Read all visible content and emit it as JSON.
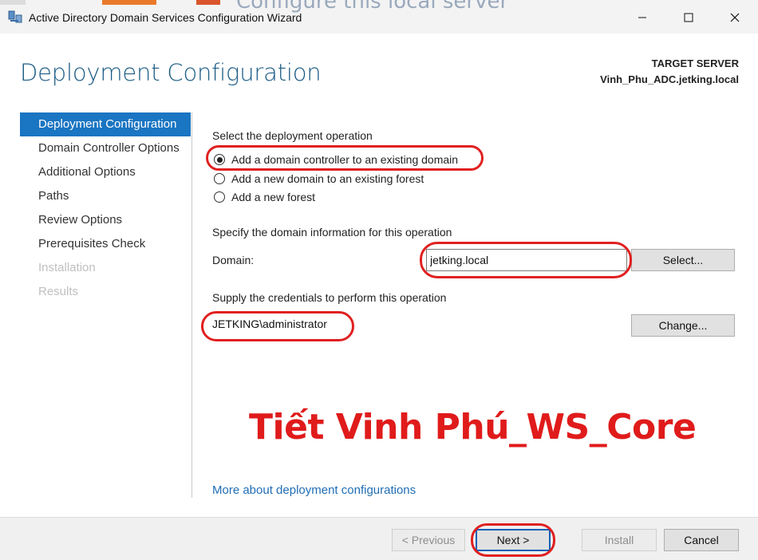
{
  "window": {
    "title": "Active Directory Domain Services Configuration Wizard",
    "background_text": "Configure this local server",
    "app_icon": "ad-ds-icon"
  },
  "header": {
    "page_title": "Deployment Configuration",
    "target_label": "TARGET SERVER",
    "target_name": "Vinh_Phu_ADC.jetking.local"
  },
  "nav": {
    "items": [
      {
        "label": "Deployment Configuration",
        "state": "active"
      },
      {
        "label": "Domain Controller Options",
        "state": "enabled"
      },
      {
        "label": "Additional Options",
        "state": "enabled"
      },
      {
        "label": "Paths",
        "state": "enabled"
      },
      {
        "label": "Review Options",
        "state": "enabled"
      },
      {
        "label": "Prerequisites Check",
        "state": "enabled"
      },
      {
        "label": "Installation",
        "state": "disabled"
      },
      {
        "label": "Results",
        "state": "disabled"
      }
    ]
  },
  "content": {
    "operation_label": "Select the deployment operation",
    "operations": [
      {
        "label": "Add a domain controller to an existing domain",
        "selected": true
      },
      {
        "label": "Add a new domain to an existing forest",
        "selected": false
      },
      {
        "label": "Add a new forest",
        "selected": false
      }
    ],
    "domain_section_label": "Specify the domain information for this operation",
    "domain_label": "Domain:",
    "domain_value": "jetking.local",
    "select_button": "Select...",
    "credentials_label": "Supply the credentials to perform this operation",
    "credentials_value": "JETKING\\administrator",
    "change_button": "Change...",
    "watermark": "Tiết Vinh Phú_WS_Core",
    "more_link": "More about deployment configurations"
  },
  "footer": {
    "previous": "< Previous",
    "next": "Next >",
    "install": "Install",
    "cancel": "Cancel"
  },
  "colors": {
    "accent": "#1a75c2",
    "title": "#1a5b84",
    "link": "#1f6db5",
    "annotation": "#e02020"
  }
}
